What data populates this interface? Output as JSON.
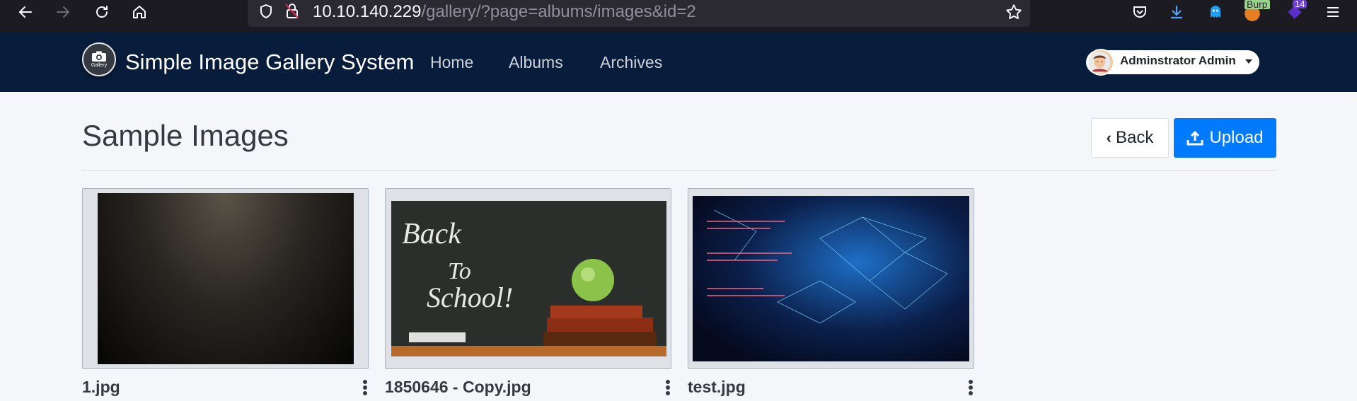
{
  "browser": {
    "url_host": "10.10.140.229",
    "url_path": "/gallery/?page=albums/images&id=2",
    "burp_label": "Burp",
    "ext_badge": "14"
  },
  "navbar": {
    "logo_text": "Gallery",
    "brand": "Simple Image Gallery System",
    "links": [
      "Home",
      "Albums",
      "Archives"
    ],
    "user_name": "Adminstrator Admin"
  },
  "page": {
    "title": "Sample Images",
    "back_label": "Back",
    "upload_label": "Upload"
  },
  "images": [
    {
      "name": "1.jpg"
    },
    {
      "name": "1850646 - Copy.jpg"
    },
    {
      "name": "test.jpg"
    }
  ],
  "colors": {
    "navbar": "#071d3b",
    "primary": "#007bff",
    "background": "#f4f6f9"
  }
}
